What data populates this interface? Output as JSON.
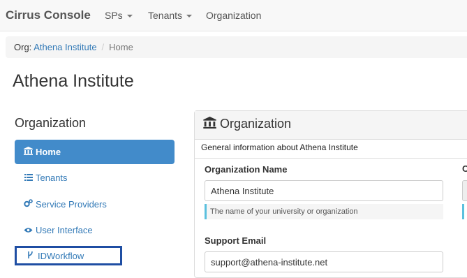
{
  "navbar": {
    "brand": "Cirrus Console",
    "items": [
      {
        "label": "SPs",
        "dropdown": true
      },
      {
        "label": "Tenants",
        "dropdown": true
      },
      {
        "label": "Organization",
        "dropdown": false
      }
    ]
  },
  "breadcrumb": {
    "prefix": "Org:",
    "link": "Athena Institute",
    "separator": "/",
    "active": "Home"
  },
  "page_title": "Athena Institute",
  "sidebar": {
    "heading": "Organization",
    "items": [
      {
        "label": "Home",
        "icon": "institution-icon",
        "state": "active"
      },
      {
        "label": "Tenants",
        "icon": "list-icon",
        "state": "normal"
      },
      {
        "label": "Service Providers",
        "icon": "gears-icon",
        "state": "normal"
      },
      {
        "label": "User Interface",
        "icon": "eye-icon",
        "state": "normal"
      },
      {
        "label": "IDWorkflow",
        "icon": "fork-icon",
        "state": "focused"
      }
    ]
  },
  "panel": {
    "title": "Organization",
    "icon": "institution-icon",
    "description": "General information about Athena Institute",
    "fields": {
      "org_name": {
        "label": "Organization Name",
        "value": "Athena Institute",
        "help": "The name of your university or organization"
      },
      "support_email": {
        "label": "Support Email",
        "value": "support@athena-institute.net"
      },
      "cut_off_label": "C"
    }
  },
  "colors": {
    "active_pill": "#428bca",
    "link": "#337ab7",
    "focus_outline": "#1f4ea3",
    "help_accent": "#5bc0de"
  }
}
